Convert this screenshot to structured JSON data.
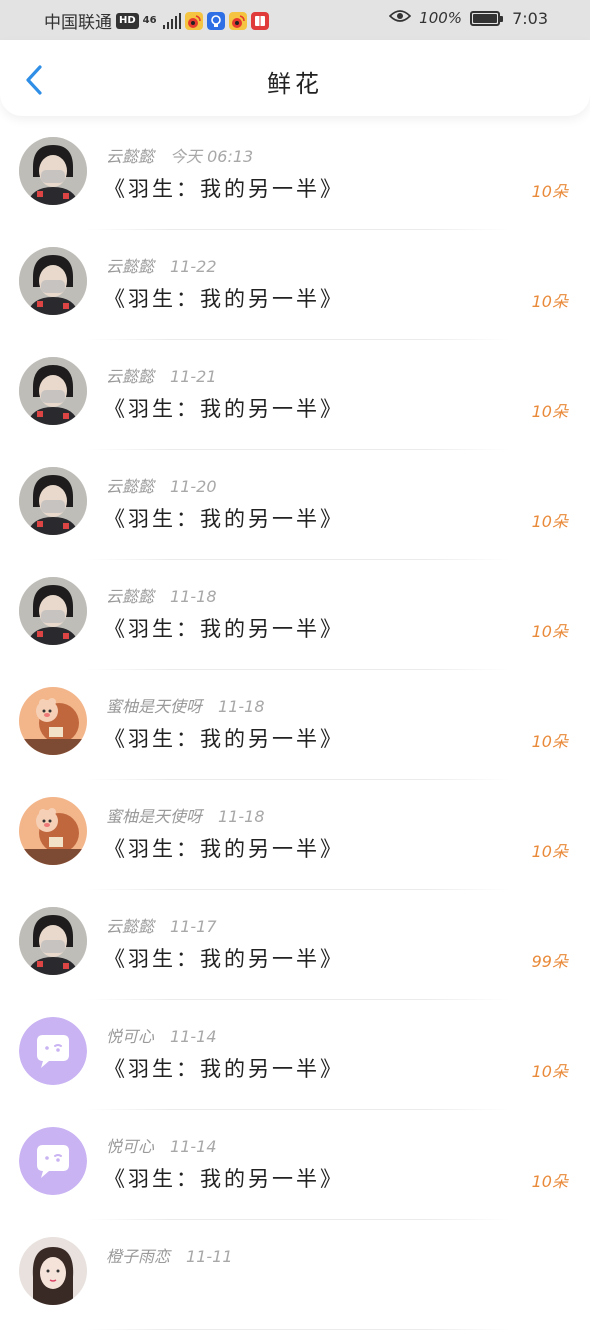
{
  "status_bar": {
    "carrier": "中国联通",
    "hd": "HD",
    "network": "46",
    "battery": "100%",
    "time": "7:03"
  },
  "header": {
    "title": "鲜花"
  },
  "entries": [
    {
      "name": "云懿懿",
      "time": "今天 06:13",
      "book": "《羽生：我的另一半》",
      "amount": "10朵",
      "avatar": "user-photo-masked"
    },
    {
      "name": "云懿懿",
      "time": "11-22",
      "book": "《羽生：我的另一半》",
      "amount": "10朵",
      "avatar": "user-photo-masked"
    },
    {
      "name": "云懿懿",
      "time": "11-21",
      "book": "《羽生：我的另一半》",
      "amount": "10朵",
      "avatar": "user-photo-masked"
    },
    {
      "name": "云懿懿",
      "time": "11-20",
      "book": "《羽生：我的另一半》",
      "amount": "10朵",
      "avatar": "user-photo-masked"
    },
    {
      "name": "云懿懿",
      "time": "11-18",
      "book": "《羽生：我的另一半》",
      "amount": "10朵",
      "avatar": "user-photo-masked"
    },
    {
      "name": "蜜柚是天使呀",
      "time": "11-18",
      "book": "《羽生：我的另一半》",
      "amount": "10朵",
      "avatar": "cartoon-bear"
    },
    {
      "name": "蜜柚是天使呀",
      "time": "11-18",
      "book": "《羽生：我的另一半》",
      "amount": "10朵",
      "avatar": "cartoon-bear"
    },
    {
      "name": "云懿懿",
      "time": "11-17",
      "book": "《羽生：我的另一半》",
      "amount": "99朵",
      "avatar": "user-photo-masked"
    },
    {
      "name": "悦可心",
      "time": "11-14",
      "book": "《羽生：我的另一半》",
      "amount": "10朵",
      "avatar": "default-chat-bubble"
    },
    {
      "name": "悦可心",
      "time": "11-14",
      "book": "《羽生：我的另一半》",
      "amount": "10朵",
      "avatar": "default-chat-bubble"
    },
    {
      "name": "橙子雨恋",
      "time": "11-11",
      "book": "",
      "amount": "",
      "avatar": "user-photo-girl"
    }
  ],
  "colors": {
    "accent": "#2f8ee6",
    "amount": "#e98a3a",
    "muted_text": "#9a9a9a",
    "default_avatar": "#c9b3f2"
  }
}
